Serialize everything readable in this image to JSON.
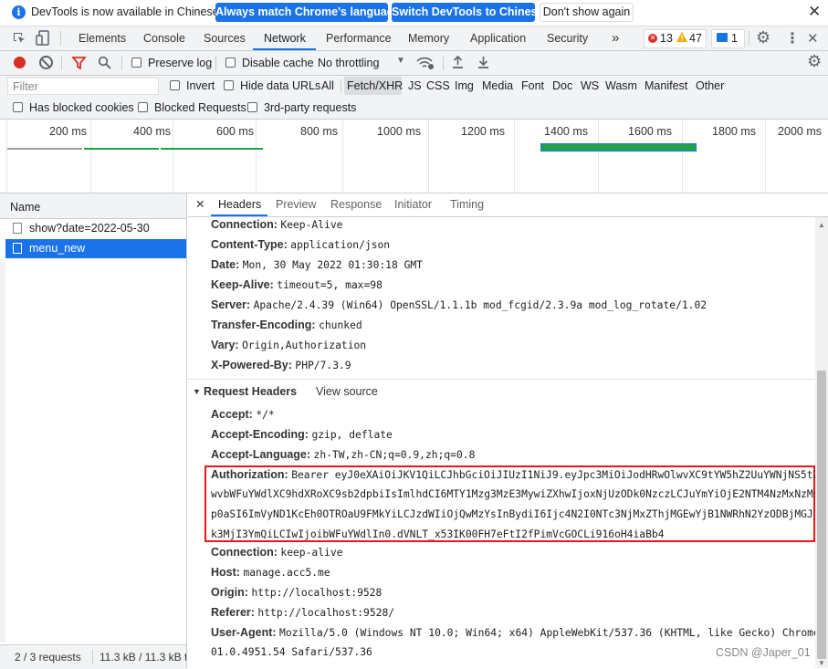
{
  "infobar": {
    "message": "DevTools is now available in Chinese!",
    "match_button": "Always match Chrome's language",
    "switch_button": "Switch DevTools to Chinese",
    "dismiss_button": "Don't show again"
  },
  "tabs": [
    "Elements",
    "Console",
    "Sources",
    "Network",
    "Performance",
    "Memory",
    "Application",
    "Security"
  ],
  "active_tab": "Network",
  "badges": {
    "errors": "13",
    "warnings": "47",
    "messages": "1"
  },
  "toolbar": {
    "preserve_log": "Preserve log",
    "disable_cache": "Disable cache",
    "throttling": "No throttling"
  },
  "filter": {
    "placeholder": "Filter",
    "invert": "Invert",
    "hide_data_urls": "Hide data URLs",
    "types": [
      "All",
      "Fetch/XHR",
      "JS",
      "CSS",
      "Img",
      "Media",
      "Font",
      "Doc",
      "WS",
      "Wasm",
      "Manifest",
      "Other"
    ],
    "active_type": "Fetch/XHR",
    "has_blocked_cookies": "Has blocked cookies",
    "blocked_requests": "Blocked Requests",
    "third_party": "3rd-party requests"
  },
  "timeline": {
    "ticks": [
      "200 ms",
      "400 ms",
      "600 ms",
      "800 ms",
      "1000 ms",
      "1200 ms",
      "1400 ms",
      "1600 ms",
      "1800 ms",
      "2000 ms"
    ]
  },
  "requests": {
    "header": "Name",
    "items": [
      "show?date=2022-05-30",
      "menu_new"
    ],
    "selected": "menu_new",
    "status_count": "2 / 3 requests",
    "status_size": "11.3 kB / 11.3 kB t"
  },
  "detail_tabs": [
    "Headers",
    "Preview",
    "Response",
    "Initiator",
    "Timing"
  ],
  "active_detail_tab": "Headers",
  "response_headers": [
    {
      "name": "Connection:",
      "value": "Keep-Alive"
    },
    {
      "name": "Content-Type:",
      "value": "application/json"
    },
    {
      "name": "Date:",
      "value": "Mon, 30 May 2022 01:30:18 GMT"
    },
    {
      "name": "Keep-Alive:",
      "value": "timeout=5, max=98"
    },
    {
      "name": "Server:",
      "value": "Apache/2.4.39 (Win64) OpenSSL/1.1.1b mod_fcgid/2.3.9a mod_log_rotate/1.02"
    },
    {
      "name": "Transfer-Encoding:",
      "value": "chunked"
    },
    {
      "name": "Vary:",
      "value": "Origin,Authorization"
    },
    {
      "name": "X-Powered-By:",
      "value": "PHP/7.3.9"
    }
  ],
  "request_section": {
    "title": "Request Headers",
    "view_source": "View source"
  },
  "request_headers_top": [
    {
      "name": "Accept:",
      "value": "*/*"
    },
    {
      "name": "Accept-Encoding:",
      "value": "gzip, deflate"
    },
    {
      "name": "Accept-Language:",
      "value": "zh-TW,zh-CN;q=0.9,zh;q=0.8"
    }
  ],
  "authorization": {
    "name": "Authorization:",
    "line1": "Bearer eyJ0eXAiOiJKV1QiLCJhbGciOiJIUzI1NiJ9.eyJpc3MiOiJodHRwOlwvXC9tYW5hZ2UuYWNjNS5tZV",
    "line2": "wvbWFuYWdlXC9hdXRoXC9sb2dpbiIsImlhdCI6MTY1Mzg3MzE3MywiZXhwIjoxNjUzODk0NzczLCJuYmYiOjE2NTM4NzMxNzMsIm",
    "line3": "p0aSI6ImVyND1KcEh0OTROaU9FMkYiLCJzdWIiOjQwMzYsInBydiI6Ijc4N2I0NTc3NjMxZThjMGEwYjB1NWRhN2YzODBjMGJjOD",
    "line4": "k3MjI3YmQiLCIwIjoibWFuYWdlIn0.dVNLT_x53IK00FH7eFtI2fPimVcGOCLi916oH4iaBb4"
  },
  "request_headers_bottom": [
    {
      "name": "Connection:",
      "value": "keep-alive"
    },
    {
      "name": "Host:",
      "value": "manage.acc5.me"
    },
    {
      "name": "Origin:",
      "value": "http://localhost:9528"
    },
    {
      "name": "Referer:",
      "value": "http://localhost:9528/"
    },
    {
      "name": "User-Agent:",
      "value": "Mozilla/5.0 (Windows NT 10.0; Win64; x64) AppleWebKit/537.36 (KHTML, like Gecko) Chrome/1"
    }
  ],
  "user_agent_cont": "01.0.4951.54 Safari/537.36",
  "watermark": "CSDN @Japer_01",
  "colors": {
    "accent": "#1a73e8",
    "highlight_box": "#e8191d",
    "timeline_green": "#1ea446"
  }
}
